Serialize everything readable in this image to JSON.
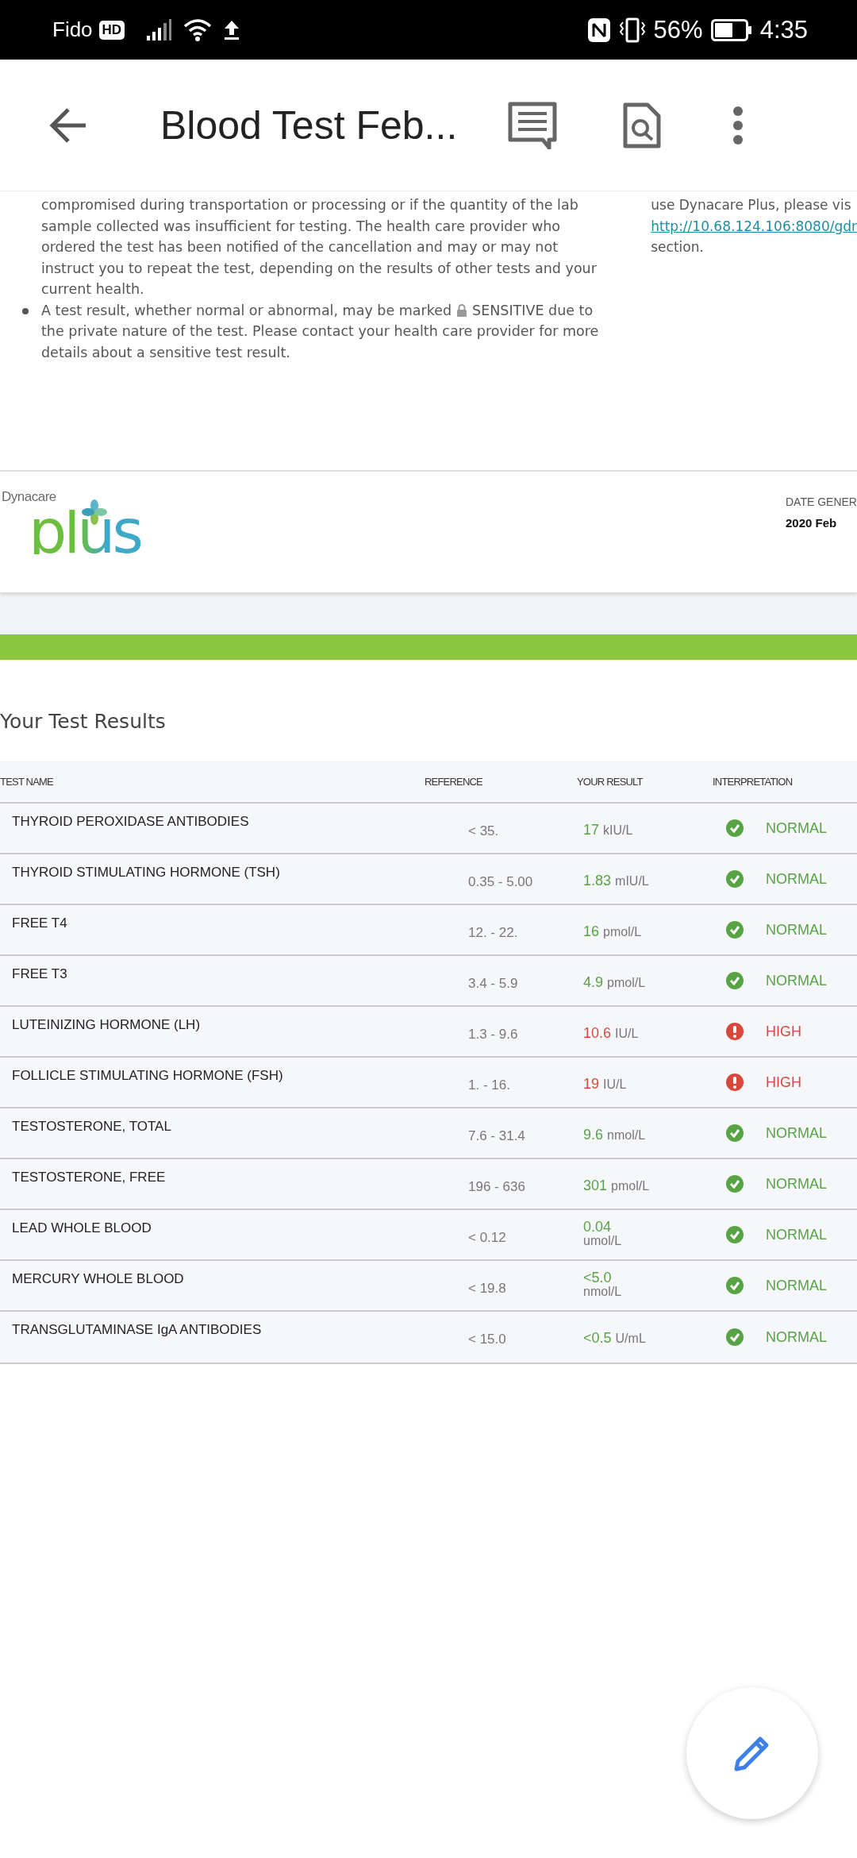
{
  "status_bar": {
    "carrier": "Fido",
    "network_badge": "HD",
    "battery_percent": "56%",
    "time": "4:35"
  },
  "app_bar": {
    "title": "Blood Test Feb..."
  },
  "notes": {
    "continuation": "compromised during transportation or processing or if the quantity of the lab sample collected was insufficient for testing. The health care provider who ordered the test has been notified of the cancellation and may or may not instruct you to repeat the test, depending on the results of other tests and your current health.",
    "bullet_before_icon": "A test result, whether normal or abnormal, may be marked",
    "bullet_after_icon": "SENSITIVE due to",
    "bullet_rest": "the private nature of the test. Please contact your health care provider for more details about a sensitive test result.",
    "side_text": "use Dynacare Plus, please vis",
    "side_link": "http://10.68.124.106:8080/gdr",
    "side_tail": "section."
  },
  "header": {
    "logo_small": "Dynacare",
    "logo_large": "plus",
    "date_label": "DATE GENER",
    "date_value": "2020 Feb"
  },
  "results": {
    "title": "Your Test Results",
    "columns": [
      "TEST NAME",
      "REFERENCE",
      "YOUR RESULT",
      "INTERPRETATION"
    ],
    "rows": [
      {
        "name": "THYROID PEROXIDASE ANTIBODIES",
        "reference": "< 35.",
        "value": "17",
        "unit": "kIU/L",
        "unit_on_new_line": false,
        "kind": "normal",
        "interpretation": "NORMAL"
      },
      {
        "name": "THYROID STIMULATING HORMONE (TSH)",
        "reference": "0.35 - 5.00",
        "value": "1.83",
        "unit": "mIU/L",
        "unit_on_new_line": false,
        "kind": "normal",
        "interpretation": "NORMAL"
      },
      {
        "name": "FREE T4",
        "reference": "12. - 22.",
        "value": "16",
        "unit": "pmol/L",
        "unit_on_new_line": false,
        "kind": "normal",
        "interpretation": "NORMAL"
      },
      {
        "name": "FREE T3",
        "reference": "3.4 - 5.9",
        "value": "4.9",
        "unit": "pmol/L",
        "unit_on_new_line": false,
        "kind": "normal",
        "interpretation": "NORMAL"
      },
      {
        "name": "LUTEINIZING HORMONE (LH)",
        "reference": "1.3 - 9.6",
        "value": "10.6",
        "unit": "IU/L",
        "unit_on_new_line": false,
        "kind": "high",
        "interpretation": "HIGH"
      },
      {
        "name": "FOLLICLE STIMULATING HORMONE (FSH)",
        "reference": "1. - 16.",
        "value": "19",
        "unit": "IU/L",
        "unit_on_new_line": false,
        "kind": "high",
        "interpretation": "HIGH"
      },
      {
        "name": "TESTOSTERONE, TOTAL",
        "reference": "7.6 - 31.4",
        "value": "9.6",
        "unit": "nmol/L",
        "unit_on_new_line": false,
        "kind": "normal",
        "interpretation": "NORMAL"
      },
      {
        "name": "TESTOSTERONE, FREE",
        "reference": "196 - 636",
        "value": "301",
        "unit": "pmol/L",
        "unit_on_new_line": false,
        "kind": "normal",
        "interpretation": "NORMAL"
      },
      {
        "name": "LEAD WHOLE BLOOD",
        "reference": "< 0.12",
        "value": "0.04",
        "unit": "umol/L",
        "unit_on_new_line": true,
        "kind": "normal",
        "interpretation": "NORMAL"
      },
      {
        "name": "MERCURY WHOLE BLOOD",
        "reference": "< 19.8",
        "value": "<5.0",
        "unit": "nmol/L",
        "unit_on_new_line": true,
        "kind": "normal",
        "interpretation": "NORMAL"
      },
      {
        "name": "TRANSGLUTAMINASE IgA ANTIBODIES",
        "reference": "< 15.0",
        "value": "<0.5",
        "unit": "U/mL",
        "unit_on_new_line": false,
        "kind": "normal",
        "interpretation": "NORMAL"
      }
    ]
  }
}
